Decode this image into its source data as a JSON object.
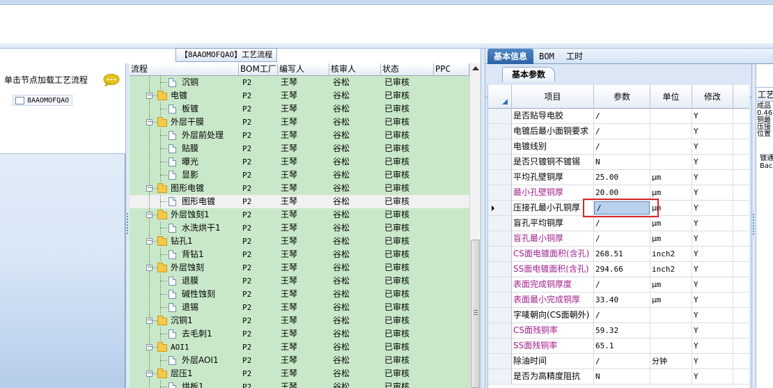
{
  "left_panel": {
    "hint": "单击节点加载工艺流程",
    "tree_root": "8AAOMOFQAO"
  },
  "workflow_tab": "【8AAOMOFQAO】工艺流程",
  "grid": {
    "columns": [
      "流程",
      "BOM工厂",
      "编写人",
      "核审人",
      "状态",
      "PPC"
    ],
    "rows": [
      {
        "name": "沉铜",
        "level": 1,
        "type": "doc",
        "bom": "P2",
        "writer": "王琴",
        "reviewer": "谷松",
        "status": "已审核"
      },
      {
        "name": "电镀",
        "level": 0,
        "type": "folder",
        "bom": "P2",
        "writer": "王琴",
        "reviewer": "谷松",
        "status": "已审核"
      },
      {
        "name": "板镀",
        "level": 1,
        "type": "doc",
        "bom": "P2",
        "writer": "王琴",
        "reviewer": "谷松",
        "status": "已审核"
      },
      {
        "name": "外层干膜",
        "level": 0,
        "type": "folder",
        "bom": "P2",
        "writer": "王琴",
        "reviewer": "谷松",
        "status": "已审核"
      },
      {
        "name": "外层前处理",
        "level": 1,
        "type": "doc",
        "bom": "P2",
        "writer": "王琴",
        "reviewer": "谷松",
        "status": "已审核"
      },
      {
        "name": "贴膜",
        "level": 1,
        "type": "doc",
        "bom": "P2",
        "writer": "王琴",
        "reviewer": "谷松",
        "status": "已审核"
      },
      {
        "name": "曝光",
        "level": 1,
        "type": "doc",
        "bom": "P2",
        "writer": "王琴",
        "reviewer": "谷松",
        "status": "已审核"
      },
      {
        "name": "显影",
        "level": 1,
        "type": "doc",
        "bom": "P2",
        "writer": "王琴",
        "reviewer": "谷松",
        "status": "已审核"
      },
      {
        "name": "图形电镀",
        "level": 0,
        "type": "folder",
        "bom": "P2",
        "writer": "王琴",
        "reviewer": "谷松",
        "status": "已审核"
      },
      {
        "name": "图形电镀",
        "level": 1,
        "type": "doc",
        "bom": "P2",
        "writer": "王琴",
        "reviewer": "谷松",
        "status": "已审核",
        "selected": true
      },
      {
        "name": "外层蚀刻1",
        "level": 0,
        "type": "folder",
        "bom": "P2",
        "writer": "王琴",
        "reviewer": "谷松",
        "status": "已审核"
      },
      {
        "name": "水洗烘干1",
        "level": 1,
        "type": "doc",
        "bom": "P2",
        "writer": "王琴",
        "reviewer": "谷松",
        "status": "已审核"
      },
      {
        "name": "钻孔1",
        "level": 0,
        "type": "folder",
        "bom": "P2",
        "writer": "王琴",
        "reviewer": "谷松",
        "status": "已审核"
      },
      {
        "name": "背钻1",
        "level": 1,
        "type": "doc",
        "bom": "P2",
        "writer": "王琴",
        "reviewer": "谷松",
        "status": "已审核"
      },
      {
        "name": "外层蚀刻",
        "level": 0,
        "type": "folder",
        "bom": "P2",
        "writer": "王琴",
        "reviewer": "谷松",
        "status": "已审核"
      },
      {
        "name": "退膜",
        "level": 1,
        "type": "doc",
        "bom": "P2",
        "writer": "王琴",
        "reviewer": "谷松",
        "status": "已审核"
      },
      {
        "name": "碱性蚀刻",
        "level": 1,
        "type": "doc",
        "bom": "P2",
        "writer": "王琴",
        "reviewer": "谷松",
        "status": "已审核"
      },
      {
        "name": "退锡",
        "level": 1,
        "type": "doc",
        "bom": "P2",
        "writer": "王琴",
        "reviewer": "谷松",
        "status": "已审核"
      },
      {
        "name": "沉铜1",
        "level": 0,
        "type": "folder",
        "bom": "P2",
        "writer": "王琴",
        "reviewer": "谷松",
        "status": "已审核"
      },
      {
        "name": "去毛刺1",
        "level": 1,
        "type": "doc",
        "bom": "P2",
        "writer": "王琴",
        "reviewer": "谷松",
        "status": "已审核"
      },
      {
        "name": "AOI1",
        "level": 0,
        "type": "folder",
        "bom": "P2",
        "writer": "王琴",
        "reviewer": "谷松",
        "status": "已审核"
      },
      {
        "name": "外层AOI1",
        "level": 1,
        "type": "doc",
        "bom": "P2",
        "writer": "王琴",
        "reviewer": "谷松",
        "status": "已审核"
      },
      {
        "name": "层压1",
        "level": 0,
        "type": "folder",
        "bom": "P2",
        "writer": "王琴",
        "reviewer": "谷松",
        "status": "已审核"
      },
      {
        "name": "烘板1",
        "level": 1,
        "type": "doc",
        "bom": "P2",
        "writer": "王琴",
        "reviewer": "谷松",
        "status": "已审核"
      }
    ]
  },
  "right_panel": {
    "tabs": [
      "基本信息",
      "BOM",
      "工时"
    ],
    "subtab": "基本参数",
    "param_columns": [
      "项目",
      "参数",
      "单位",
      "修改"
    ],
    "params": [
      {
        "item": "是否贴导电胶",
        "value": "/",
        "unit": "",
        "edit": "Y",
        "purple": false
      },
      {
        "item": "电镀后最小面铜要求",
        "value": "/",
        "unit": "",
        "edit": "Y",
        "purple": false
      },
      {
        "item": "电镀线别",
        "value": "/",
        "unit": "",
        "edit": "Y",
        "purple": false
      },
      {
        "item": "是否只镀铜不镀锡",
        "value": "N",
        "unit": "",
        "edit": "Y",
        "purple": false
      },
      {
        "item": "平均孔壁铜厚",
        "value": "25.00",
        "unit": "μm",
        "edit": "Y",
        "purple": false
      },
      {
        "item": "最小孔壁铜厚",
        "value": "20.00",
        "unit": "μm",
        "edit": "Y",
        "purple": true
      },
      {
        "item": "压接孔最小孔铜厚",
        "value": "/",
        "unit": "μm",
        "edit": "Y",
        "purple": false,
        "editing": true
      },
      {
        "item": "盲孔平均铜厚",
        "value": "/",
        "unit": "μm",
        "edit": "Y",
        "purple": false
      },
      {
        "item": "盲孔最小铜厚",
        "value": "/",
        "unit": "μm",
        "edit": "Y",
        "purple": true
      },
      {
        "item": "CS面电镀面积(含孔)",
        "value": "268.51",
        "unit": "inch2",
        "edit": "Y",
        "purple": true
      },
      {
        "item": "SS面电镀面积(含孔)",
        "value": "294.66",
        "unit": "inch2",
        "edit": "Y",
        "purple": true
      },
      {
        "item": "表面完成铜厚度",
        "value": "/",
        "unit": "μm",
        "edit": "Y",
        "purple": true
      },
      {
        "item": "表面最小完成铜厚",
        "value": "33.40",
        "unit": "μm",
        "edit": "Y",
        "purple": true
      },
      {
        "item": "字唛朝向(CS面朝外)",
        "value": "/",
        "unit": "",
        "edit": "Y",
        "purple": false
      },
      {
        "item": "CS面残铜率",
        "value": "59.32",
        "unit": "",
        "edit": "Y",
        "purple": true
      },
      {
        "item": "SS面残铜率",
        "value": "65.1",
        "unit": "",
        "edit": "Y",
        "purple": true
      },
      {
        "item": "除油时间",
        "value": "/",
        "unit": "分钟",
        "edit": "Y",
        "purple": false
      },
      {
        "item": "是否为高精度阻抗",
        "value": "N",
        "unit": "",
        "edit": "Y",
        "purple": false
      }
    ]
  },
  "far_right": {
    "header": "工艺",
    "lines": [
      "成品",
      "0.46",
      "铜最",
      "压接",
      "位置"
    ],
    "lines2": [
      "镀通",
      "Bac"
    ]
  },
  "colors": {
    "grid_bg": "#c9e8c9",
    "purple_text": "#a0208e",
    "selection_box": "#d9262b",
    "active_tab": "#2d62a3"
  }
}
